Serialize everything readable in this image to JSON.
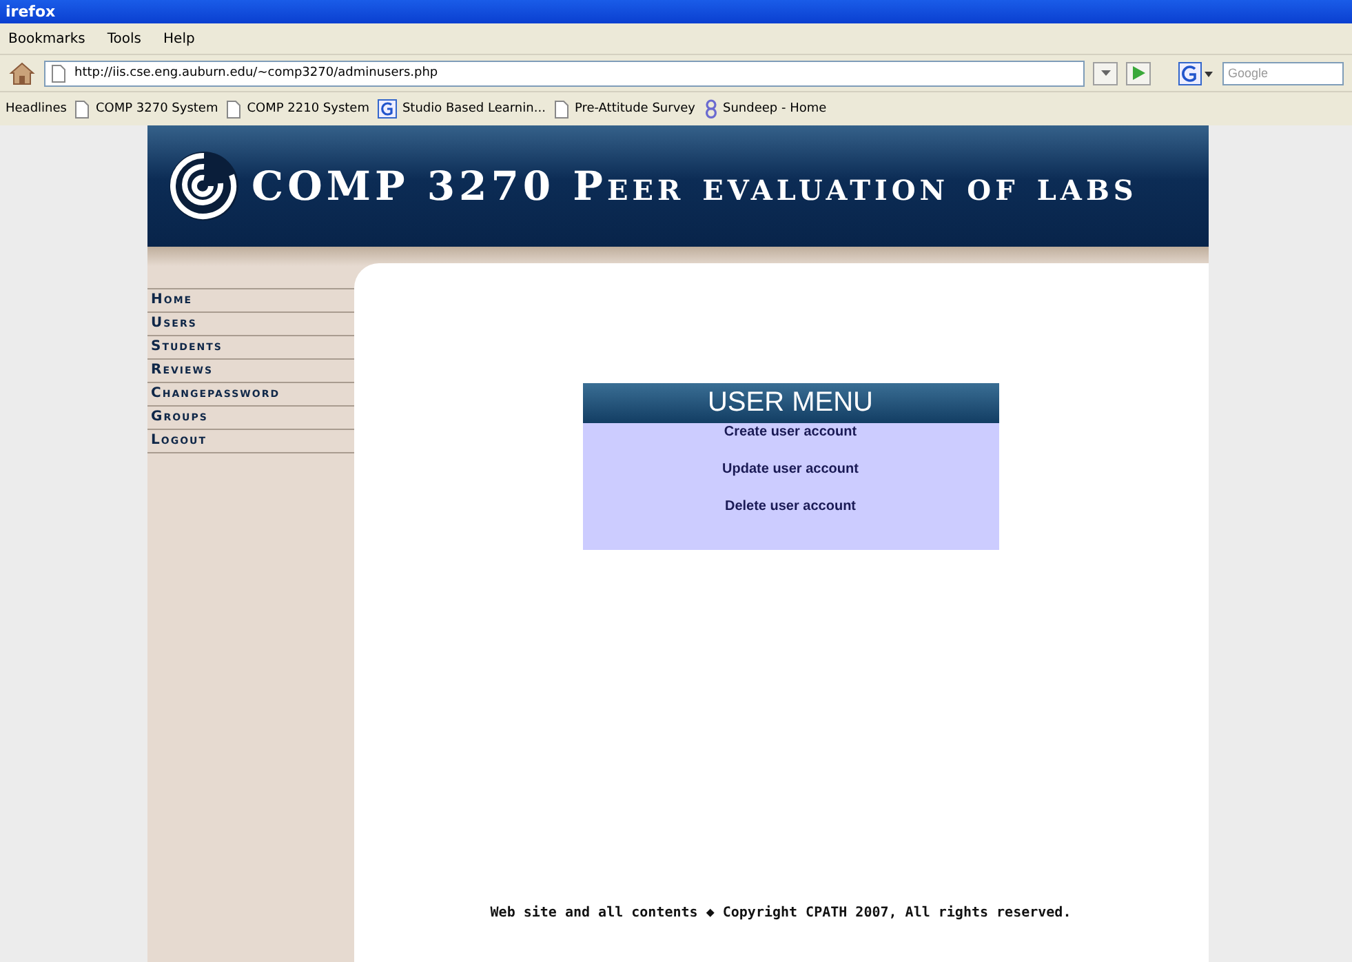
{
  "window": {
    "title": "irefox"
  },
  "menu_bar": [
    "Bookmarks",
    "Tools",
    "Help"
  ],
  "address_bar": {
    "url": "http://iis.cse.eng.auburn.edu/~comp3270/adminusers.php"
  },
  "search": {
    "placeholder": "Google"
  },
  "bookmarks": [
    {
      "label": "Headlines",
      "kind": "plain"
    },
    {
      "label": "COMP 3270 System",
      "kind": "page"
    },
    {
      "label": "COMP 2210 System",
      "kind": "page"
    },
    {
      "label": "Studio Based Learnin...",
      "kind": "google"
    },
    {
      "label": "Pre-Attitude Survey",
      "kind": "page"
    },
    {
      "label": "Sundeep - Home",
      "kind": "eight"
    }
  ],
  "site": {
    "title": "COMP 3270 Peer evaluation of labs",
    "nav": [
      "Home",
      "Users",
      "Students",
      "Reviews",
      "Changepassword",
      "Groups",
      "Logout"
    ],
    "user_menu": {
      "title": "USER MENU",
      "items": [
        "Create user account",
        "Update user account",
        "Delete user account"
      ]
    },
    "footer": "Web site and all contents ◆ Copyright CPATH 2007, All rights reserved."
  }
}
